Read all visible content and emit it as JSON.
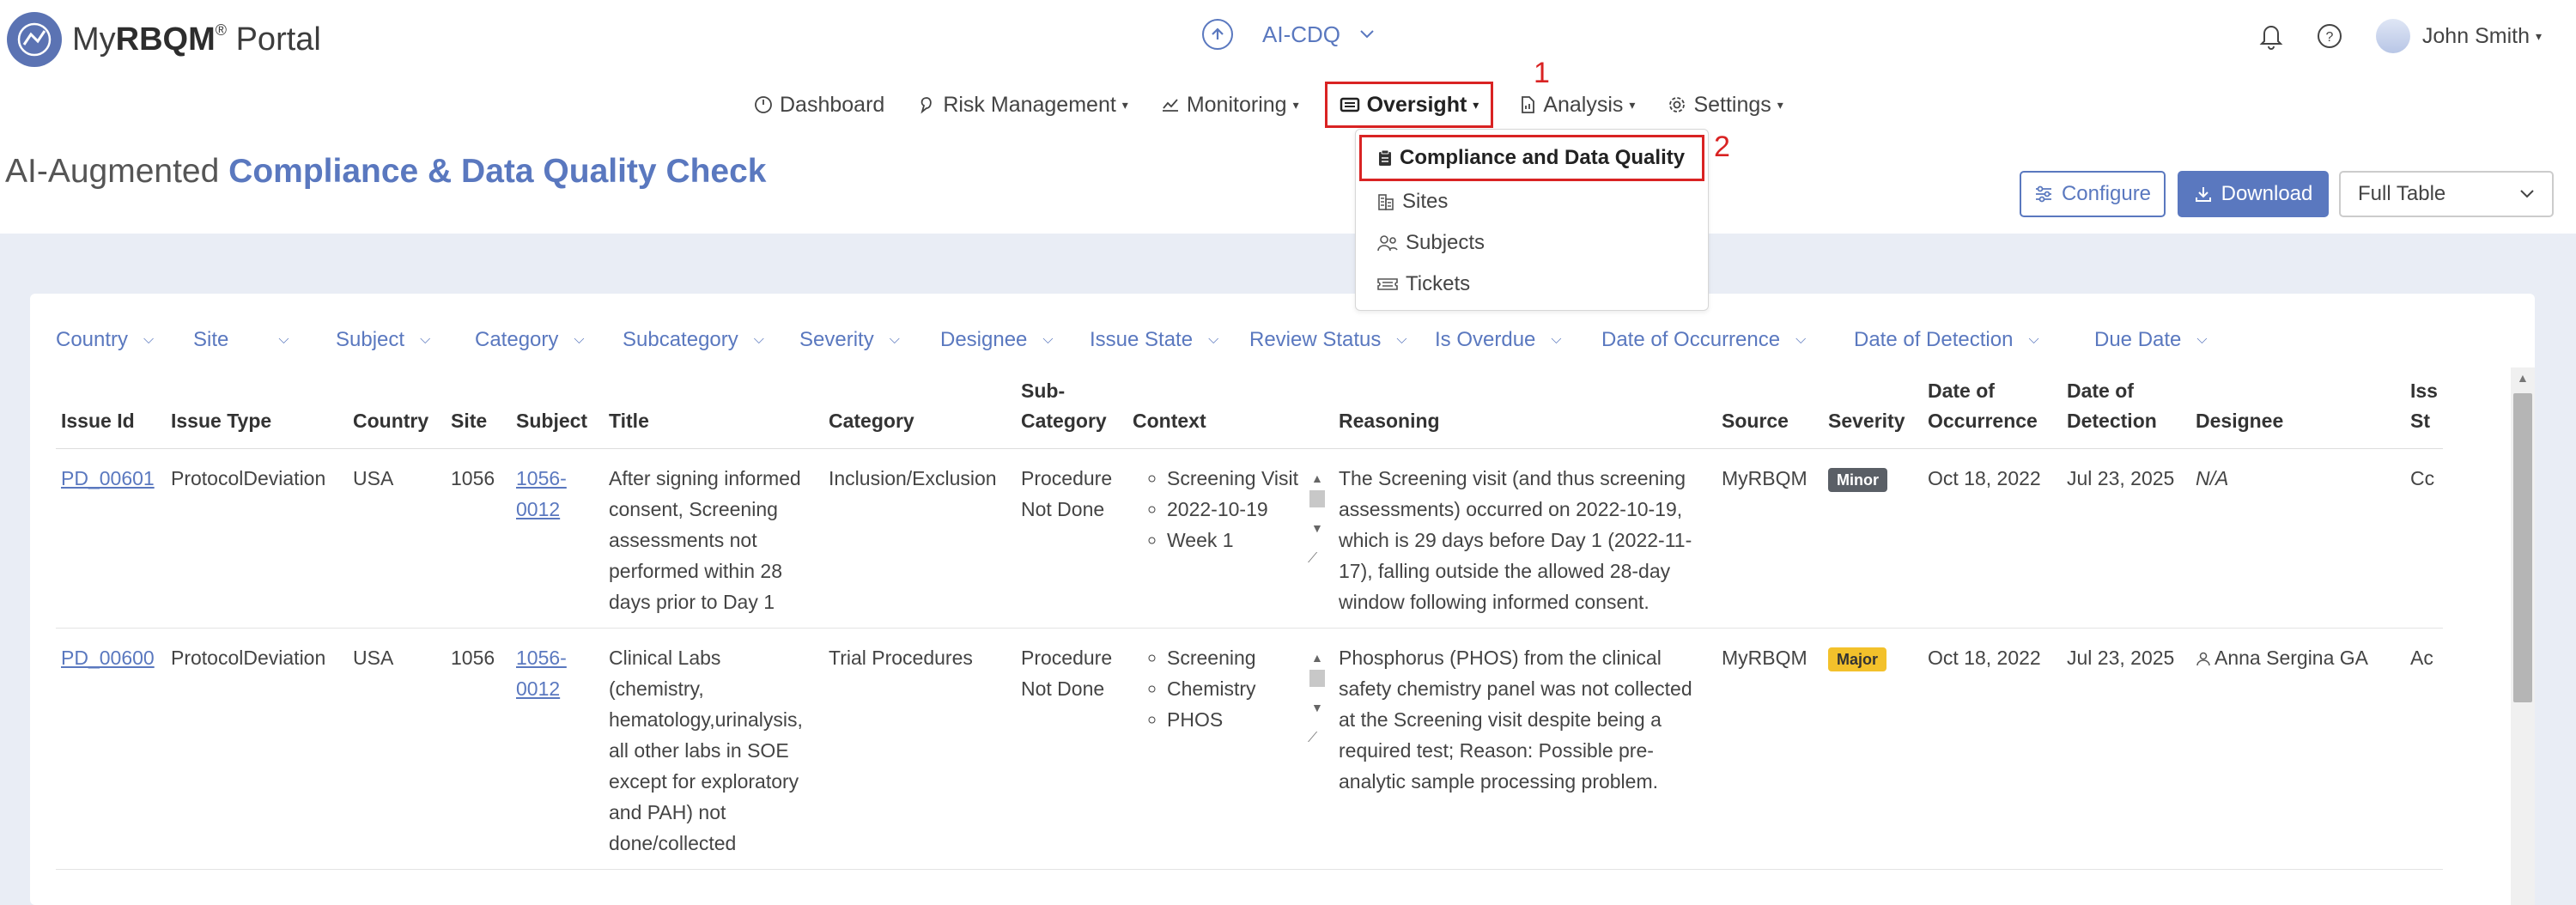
{
  "app": {
    "logo_prefix": "My",
    "logo_brand": "RBQM",
    "logo_reg": "®",
    "logo_suffix": " Portal"
  },
  "study": {
    "name": "AI-CDQ"
  },
  "user": {
    "name": "John Smith"
  },
  "nav": {
    "dashboard": "Dashboard",
    "risk": "Risk Management",
    "monitoring": "Monitoring",
    "oversight": "Oversight",
    "analysis": "Analysis",
    "settings": "Settings"
  },
  "markers": {
    "one": "1",
    "two": "2"
  },
  "oversight_menu": {
    "items": [
      "Compliance and Data Quality",
      "Sites",
      "Subjects",
      "Tickets"
    ]
  },
  "page": {
    "title_prefix": "AI-Augmented ",
    "title_main": "Compliance & Data Quality Check",
    "configure_label": "Configure",
    "download_label": "Download",
    "view_selected": "Full Table"
  },
  "filters": [
    "Country",
    "Site",
    "Subject",
    "Category",
    "Subcategory",
    "Severity",
    "Designee",
    "Issue State",
    "Review Status",
    "Is Overdue",
    "Date of Occurrence",
    "Date of Detection",
    "Due Date"
  ],
  "table": {
    "headers": {
      "issue_id": "Issue Id",
      "issue_type": "Issue Type",
      "country": "Country",
      "site": "Site",
      "subject": "Subject",
      "title": "Title",
      "category": "Category",
      "subcategory_1": "Sub-",
      "subcategory_2": "Category",
      "context": "Context",
      "reasoning": "Reasoning",
      "source": "Source",
      "severity": "Severity",
      "occ_1": "Date of",
      "occ_2": "Occurrence",
      "det_1": "Date of",
      "det_2": "Detection",
      "designee": "Designee",
      "state_1": "Iss",
      "state_2": "St"
    },
    "rows": [
      {
        "issue_id": "PD_00601",
        "issue_type": "ProtocolDeviation",
        "country": "USA",
        "site": "1056",
        "subject_1": "1056-",
        "subject_2": "0012",
        "title": "After signing informed consent, Screening assessments not performed within 28 days prior to Day 1",
        "category": "Inclusion/Exclusion",
        "subcategory": "Procedure Not Done",
        "context": [
          "Screening Visit",
          "2022-10-19",
          "Week 1"
        ],
        "reasoning": "The Screening visit (and thus screening assessments) occurred on 2022-10-19, which is 29 days before Day 1 (2022-11-17), falling outside the allowed 28-day window following informed consent.",
        "source": "MyRBQM",
        "severity": "Minor",
        "occurrence": "Oct 18, 2022",
        "detection": "Jul 23, 2025",
        "designee": "N/A",
        "state": "Cc"
      },
      {
        "issue_id": "PD_00600",
        "issue_type": "ProtocolDeviation",
        "country": "USA",
        "site": "1056",
        "subject_1": "1056-",
        "subject_2": "0012",
        "title": "Clinical Labs (chemistry, hematology,urinalysis, all other labs in SOE except for exploratory and PAH) not done/collected",
        "category": "Trial Procedures",
        "subcategory": "Procedure Not Done",
        "context": [
          "Screening",
          "Chemistry",
          "PHOS"
        ],
        "reasoning": "Phosphorus (PHOS) from the clinical safety chemistry panel was not collected at the Screening visit despite being a required test; Reason: Possible pre-analytic sample processing problem.",
        "source": "MyRBQM",
        "severity": "Major",
        "occurrence": "Oct 18, 2022",
        "detection": "Jul 23, 2025",
        "designee": "Anna Sergina GA",
        "state": "Ac"
      }
    ]
  },
  "colors": {
    "accent": "#5a78bf",
    "highlight": "#d92323",
    "minor": "#5a5f66",
    "major": "#f3c12b",
    "band": "#e9edf5"
  },
  "icons": [
    "logo-icon",
    "arrow-up-circle-icon",
    "chevron-down-icon",
    "bell-icon",
    "help-icon",
    "dashboard-icon",
    "risk-icon",
    "monitoring-icon",
    "oversight-icon",
    "analysis-icon",
    "settings-icon",
    "clipboard-icon",
    "sites-icon",
    "subjects-icon",
    "tickets-icon",
    "sliders-icon",
    "download-icon",
    "user-icon"
  ]
}
